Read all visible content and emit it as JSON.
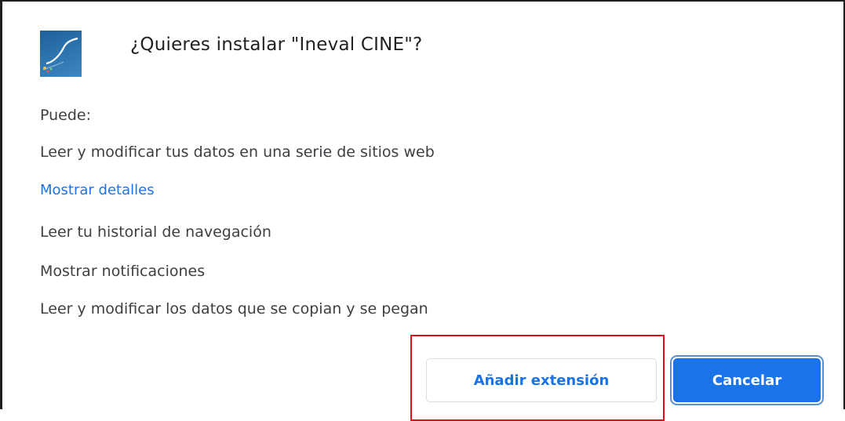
{
  "dialog": {
    "title": "¿Quieres instalar \"Ineval CINE\"?",
    "icon": "ineval-cine-extension-icon",
    "intro": "Puede:",
    "permissions": [
      "Leer y modificar tus datos en una serie de sitios web",
      "Leer tu historial de navegación",
      "Mostrar notificaciones",
      "Leer y modificar los datos que se copian y se pegan"
    ],
    "details_link": "Mostrar detalles",
    "add_button": "Añadir extensión",
    "cancel_button": "Cancelar"
  },
  "colors": {
    "link": "#1a73e8",
    "primary_button": "#1a73e8",
    "highlight_box": "#e0101a"
  }
}
